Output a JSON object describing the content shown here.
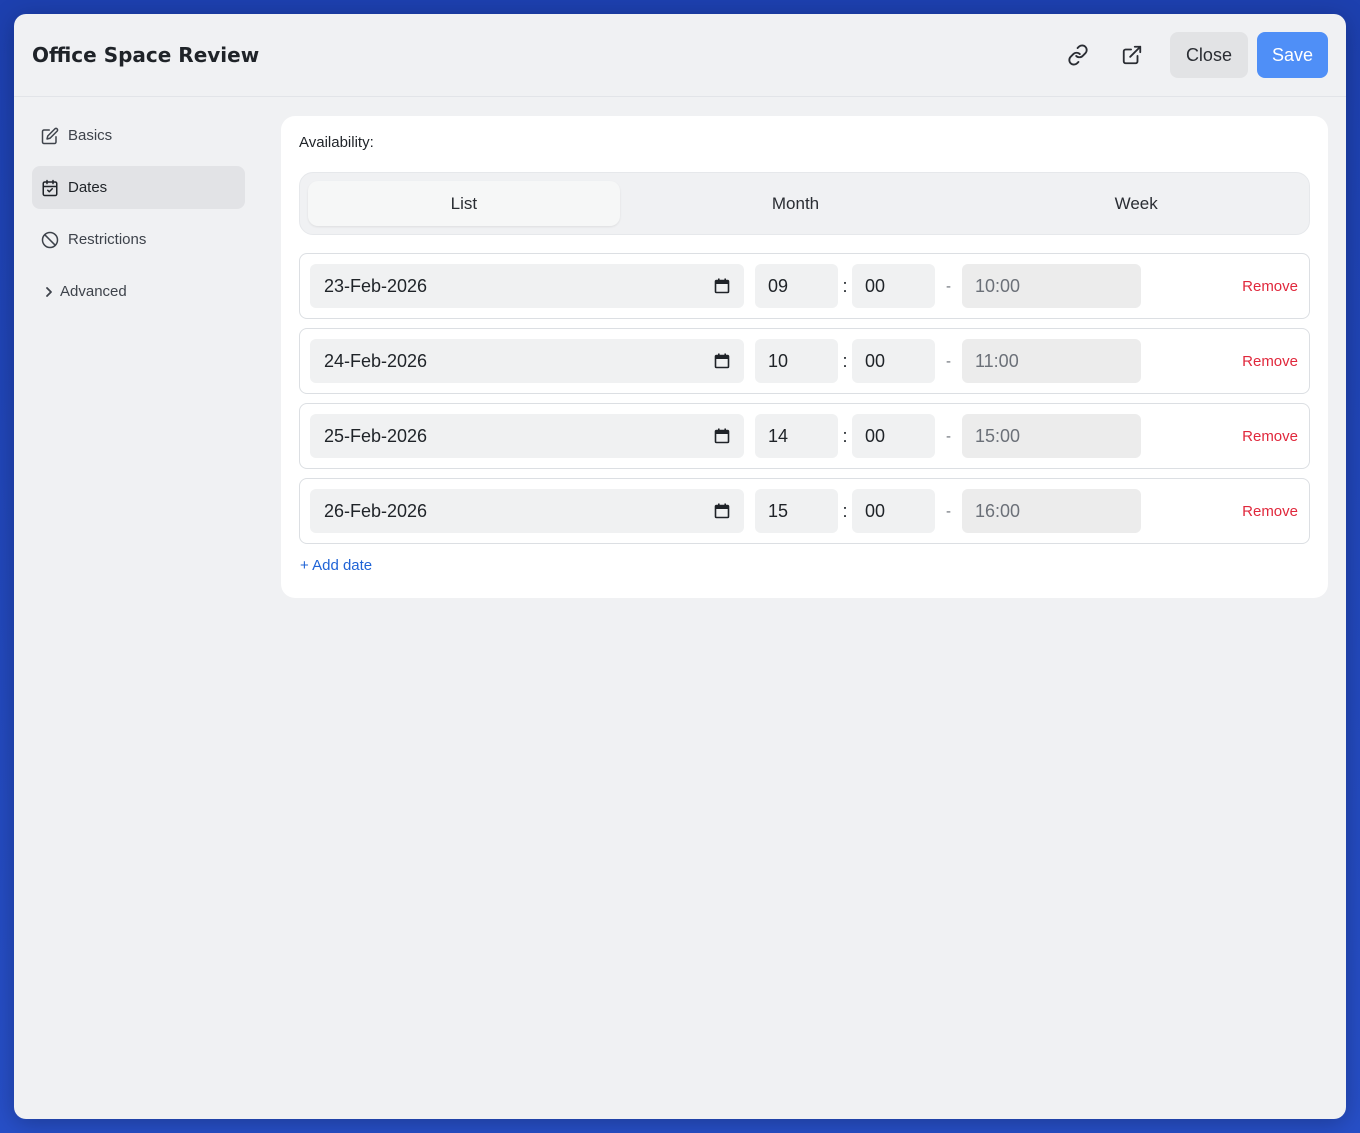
{
  "header": {
    "title": "Office Space Review",
    "close_label": "Close",
    "save_label": "Save",
    "icons": [
      "link-icon",
      "external-link-icon"
    ]
  },
  "sidebar": {
    "items": [
      {
        "label": "Basics",
        "icon": "edit-icon"
      },
      {
        "label": "Dates",
        "icon": "calendar-icon",
        "active": true
      },
      {
        "label": "Restrictions",
        "icon": "ban-icon"
      },
      {
        "label": "Advanced",
        "icon": "chevron-right-icon"
      }
    ]
  },
  "availability": {
    "label": "Availability:",
    "tabs": [
      "List",
      "Month",
      "Week"
    ],
    "active_tab": "List",
    "rows": [
      {
        "date": "23-Feb-2026",
        "hour": "09",
        "minute": "00",
        "end": "10:00",
        "remove": "Remove"
      },
      {
        "date": "24-Feb-2026",
        "hour": "10",
        "minute": "00",
        "end": "11:00",
        "remove": "Remove"
      },
      {
        "date": "25-Feb-2026",
        "hour": "14",
        "minute": "00",
        "end": "15:00",
        "remove": "Remove"
      },
      {
        "date": "26-Feb-2026",
        "hour": "15",
        "minute": "00",
        "end": "16:00",
        "remove": "Remove"
      }
    ],
    "separator_colon": ":",
    "separator_dash": "-",
    "add_date": "+ Add date"
  },
  "colors": {
    "accent": "#4f8ff7",
    "danger": "#e0283c",
    "link": "#1f63d6"
  }
}
